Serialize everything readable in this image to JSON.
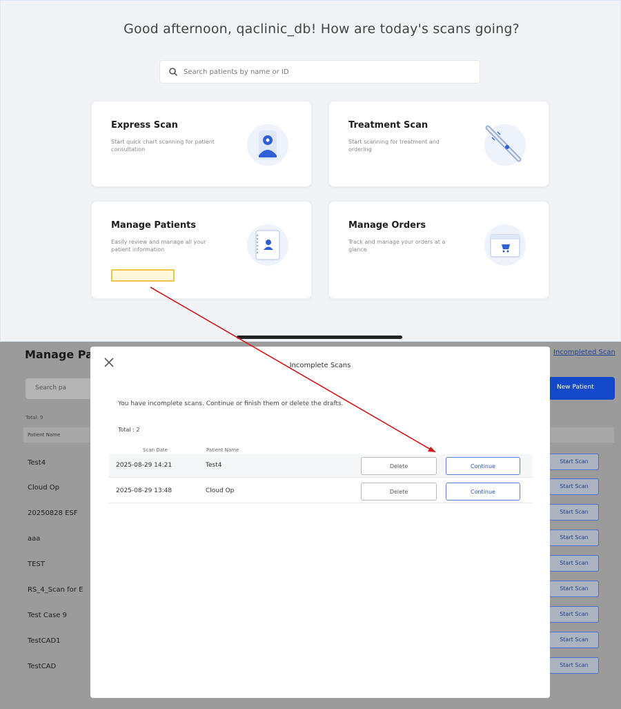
{
  "dashboard": {
    "greeting": "Good afternoon, qaclinic_db! How are today's scans going?",
    "search_placeholder": "Search patients by name or ID",
    "cards": [
      {
        "title": "Express Scan",
        "subtitle": "Start quick chart scanning for patient consultation",
        "icon": "user-scan-icon"
      },
      {
        "title": "Treatment Scan",
        "subtitle": "Start scanning for treatment and ordering",
        "icon": "scanner-wand-icon"
      },
      {
        "title": "Manage Patients",
        "subtitle": "Easily review and manage all your patient information",
        "icon": "patient-folder-icon"
      },
      {
        "title": "Manage Orders",
        "subtitle": "Track and manage your orders at a glance",
        "icon": "order-cart-icon"
      }
    ],
    "highlight_color": "#f0c64a"
  },
  "patients_page": {
    "title": "Manage Pa",
    "incomplete_link": "Incompleted Scan",
    "search_placeholder": "Search pa",
    "new_patient_label": "New Patient",
    "total_label": "Total: 9",
    "column_header": "Patient Name",
    "rows": [
      "Test4",
      "Cloud Op",
      "20250828 ESF",
      "aaa",
      "TEST",
      "RS_4_Scan for E",
      "Test Case 9",
      "TestCAD1",
      "TestCAD"
    ],
    "row_action": "Start Scan"
  },
  "modal": {
    "title": "Incomplete Scans",
    "message": "You have incomplete scans. Continue or finish them or delete the drafts.",
    "total": "Total : 2",
    "col_date": "Scan Date",
    "col_name": "Patient Name",
    "rows": [
      {
        "date": "2025-08-29 14:21",
        "name": "Test4"
      },
      {
        "date": "2025-08-29 13:48",
        "name": "Cloud Op"
      }
    ],
    "delete_label": "Delete",
    "continue_label": "Continue"
  },
  "colors": {
    "accent": "#1348c8",
    "annotation_arrow": "#d0191b"
  }
}
